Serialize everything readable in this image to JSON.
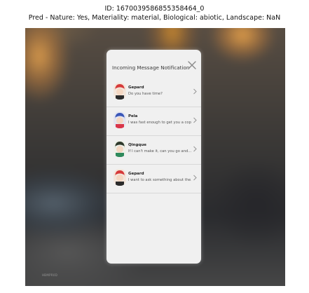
{
  "caption": {
    "line1": "ID: 1670039586855358464_0",
    "line2": "Pred - Nature: Yes, Materiality: material, Biological: abiotic, Landscape: NaN"
  },
  "screenshot": {
    "watermark": "HBMPR0D",
    "notification": {
      "title": "Incoming Message Notification",
      "close_icon": "close-icon",
      "messages": [
        {
          "name": "Gepard",
          "text": "Do you have time?",
          "avatar_color": "#d63a3a"
        },
        {
          "name": "Pela",
          "text": "I was fast enough to get you a copy too",
          "avatar_color": "#3b57b8"
        },
        {
          "name": "Qingque",
          "text": "If I can't make it, can you go and...",
          "avatar_color": "#2f8a5c"
        },
        {
          "name": "Gepard",
          "text": "I want to ask something about the...",
          "avatar_color": "#d63a3a"
        }
      ]
    }
  }
}
